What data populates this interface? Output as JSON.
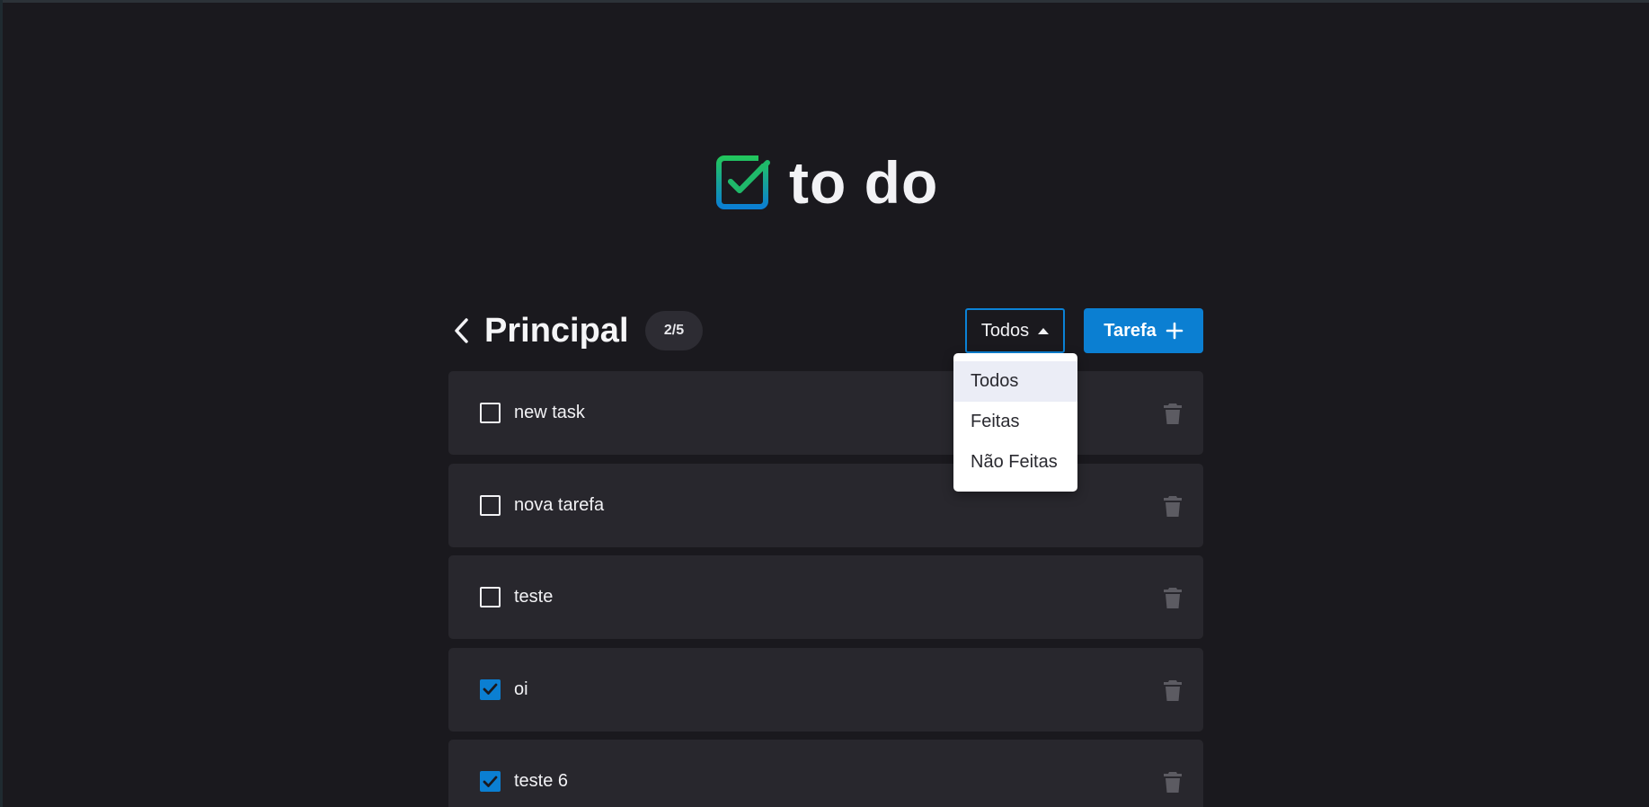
{
  "app": {
    "logo_text": "to do",
    "colors": {
      "background": "#1a191e",
      "card": "#28272d",
      "accent": "#0b7fd2",
      "logo_green": "#22c55e",
      "logo_blue": "#0b7fd2"
    }
  },
  "header": {
    "back_icon": "chevron-left-icon",
    "title": "Principal",
    "count": "2/5",
    "filter": {
      "selected": "Todos",
      "open": true
    },
    "add_button_label": "Tarefa",
    "add_icon": "plus-icon"
  },
  "dropdown": {
    "options": [
      "Todos",
      "Feitas",
      "Não Feitas"
    ],
    "active_index": 0
  },
  "tasks": [
    {
      "text": "new task",
      "done": false
    },
    {
      "text": "nova tarefa",
      "done": false
    },
    {
      "text": "teste",
      "done": false
    },
    {
      "text": "oi",
      "done": true
    },
    {
      "text": "teste 6",
      "done": true
    }
  ]
}
